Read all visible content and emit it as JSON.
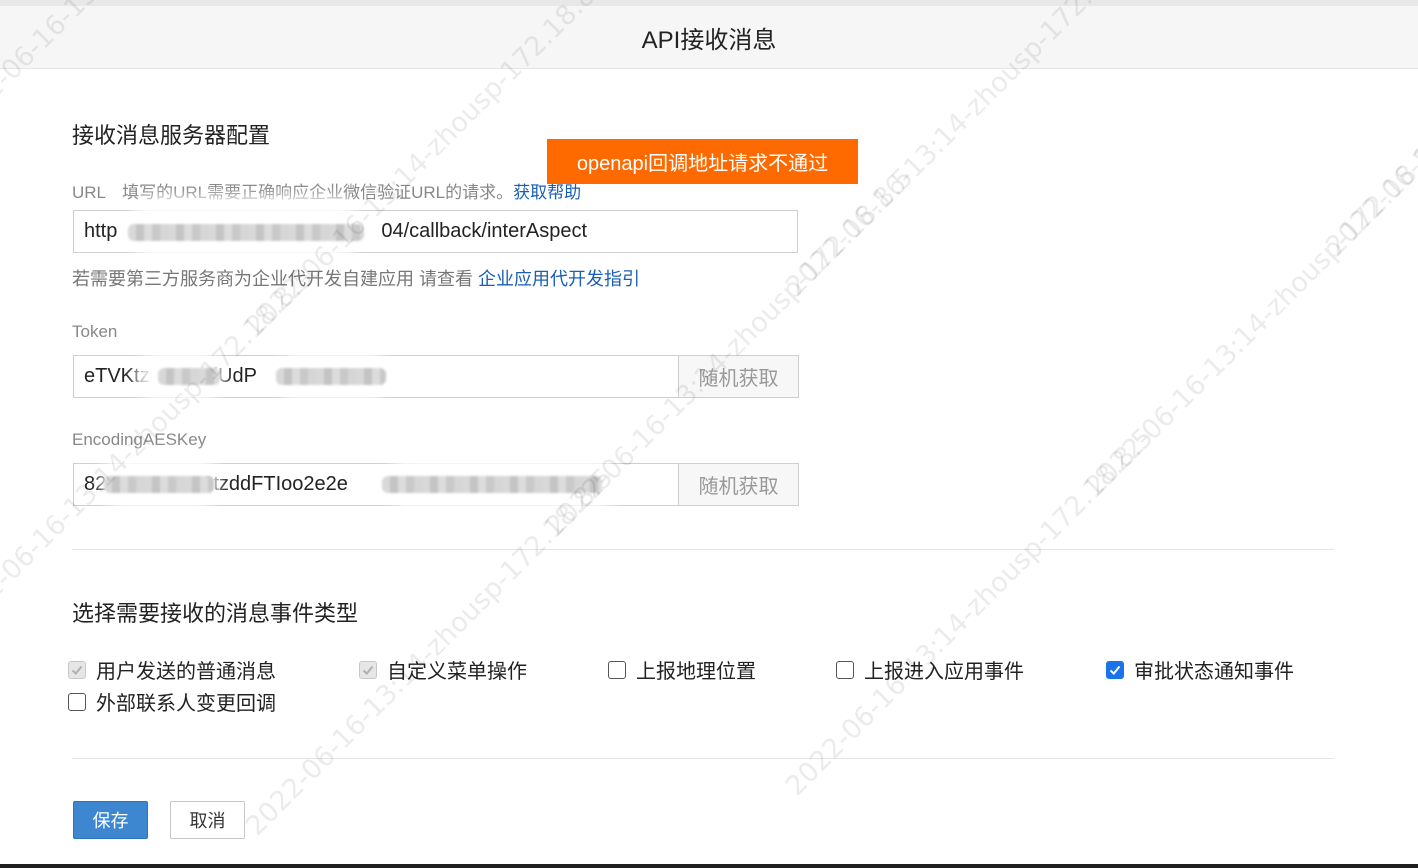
{
  "header": {
    "title": "API接收消息"
  },
  "toast": {
    "text": "openapi回调地址请求不通过"
  },
  "server_config": {
    "title": "接收消息服务器配置",
    "url_label": "URL",
    "url_hint": "填写的URL需要正确响应企业微信验证URL的请求。",
    "url_help_link": "获取帮助",
    "url_value_prefix": "http",
    "url_value_suffix": "04/callback/interAspect",
    "dev_hint": "若需要第三方服务商为企业代开发自建应用 请查看",
    "dev_guide_link": "企业应用代开发指引",
    "token_label": "Token",
    "token_value_part1": "eTVKtz",
    "token_value_part2": "iUdP",
    "aes_label": "EncodingAESKey",
    "aes_value_part1": "82",
    "aes_value_part2": "2tzddFTIoo2e2e",
    "random_button": "随机获取"
  },
  "events": {
    "title": "选择需要接收的消息事件类型",
    "items": [
      {
        "label": "用户发送的普通消息",
        "checked": true,
        "disabled": true
      },
      {
        "label": "自定义菜单操作",
        "checked": true,
        "disabled": true
      },
      {
        "label": "上报地理位置",
        "checked": false,
        "disabled": false
      },
      {
        "label": "上报进入应用事件",
        "checked": false,
        "disabled": false
      },
      {
        "label": "审批状态通知事件",
        "checked": true,
        "disabled": false
      },
      {
        "label": "外部联系人变更回调",
        "checked": false,
        "disabled": false
      }
    ]
  },
  "actions": {
    "save": "保存",
    "cancel": "取消"
  },
  "watermark": {
    "text": "2022-06-16-13:14-zhousp-172.18.8.5"
  },
  "colors": {
    "toast_bg": "#ff6a00",
    "primary": "#3c87cf",
    "link": "#1a5fb4",
    "checkbox_checked": "#1a73e8"
  }
}
